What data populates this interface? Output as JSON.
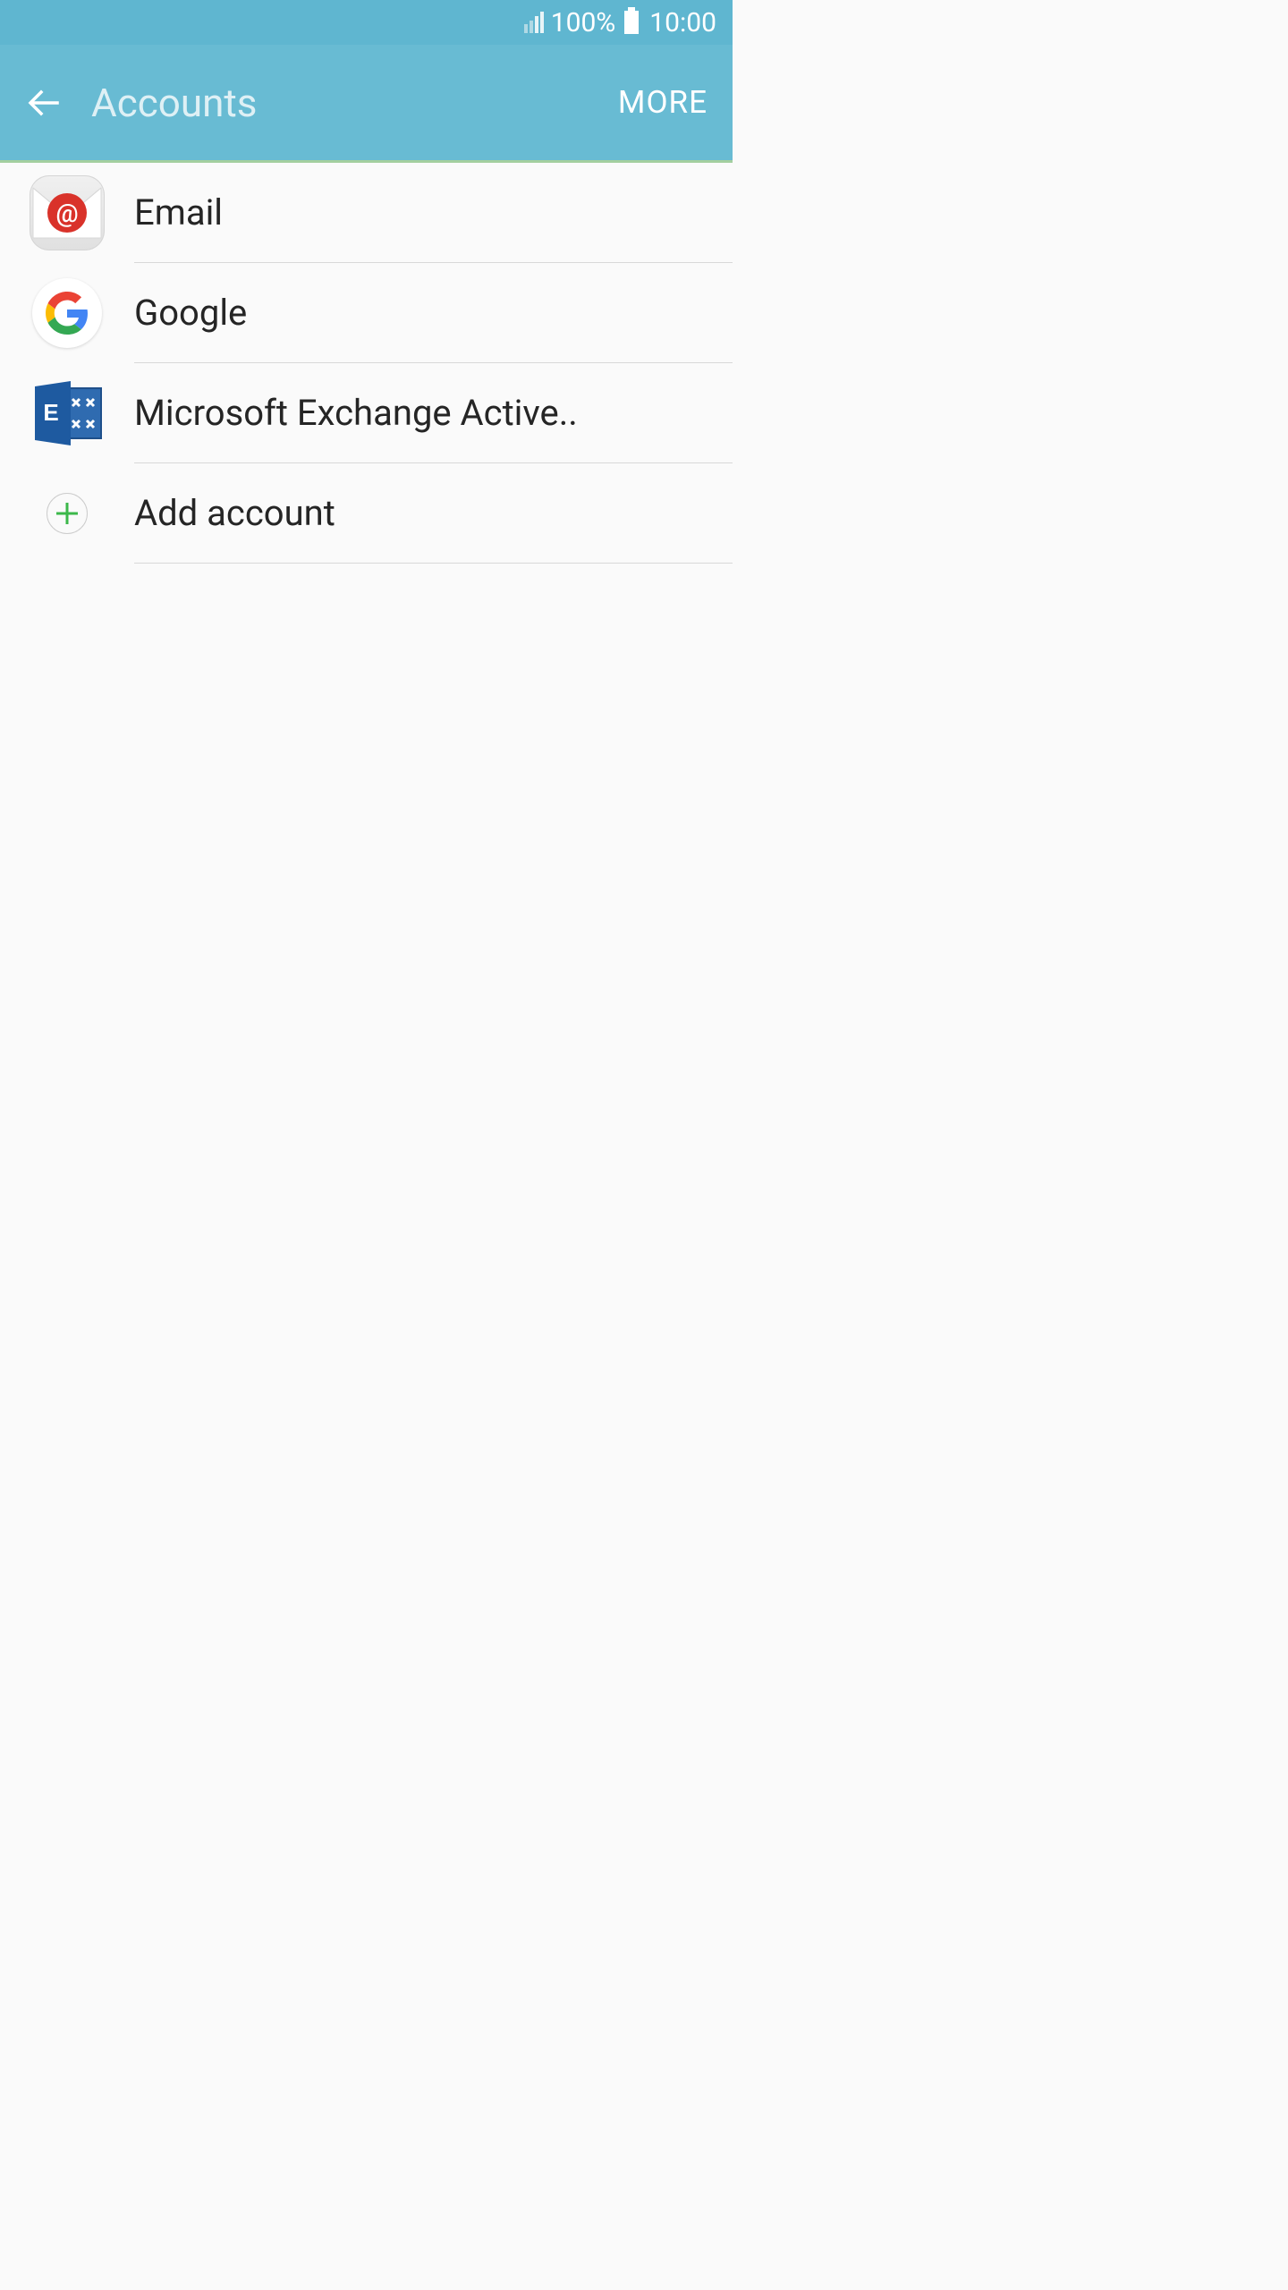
{
  "status": {
    "battery": "100%",
    "time": "10:00"
  },
  "header": {
    "title": "Accounts",
    "more_label": "MORE"
  },
  "list": {
    "items": [
      {
        "label": "Email"
      },
      {
        "label": "Google"
      },
      {
        "label": "Microsoft Exchange Active.."
      },
      {
        "label": "Add account"
      }
    ]
  }
}
